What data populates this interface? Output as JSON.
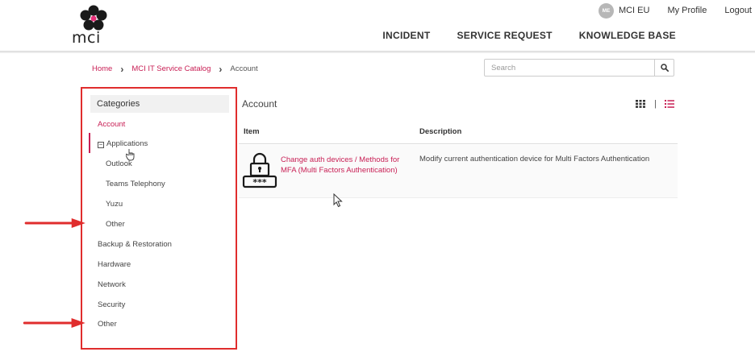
{
  "brand": {
    "logo_text": "mci",
    "accent_color": "#c81e54",
    "annotation_color": "#e02d2d"
  },
  "top_links": {
    "avatar_initials": "ME",
    "user_name": "MCI EU",
    "profile": "My Profile",
    "logout": "Logout"
  },
  "nav": {
    "items": [
      "INCIDENT",
      "SERVICE REQUEST",
      "KNOWLEDGE BASE"
    ]
  },
  "breadcrumb": {
    "items": [
      "Home",
      "MCI IT Service Catalog",
      "Account"
    ]
  },
  "search": {
    "placeholder": "Search",
    "value": "",
    "icon": "search-icon"
  },
  "sidebar": {
    "title": "Categories",
    "items": [
      {
        "label": "Account",
        "active": true
      },
      {
        "label": "Applications",
        "expanded": true
      },
      {
        "label": "Outlook",
        "level": 2
      },
      {
        "label": "Teams Telephony",
        "level": 2
      },
      {
        "label": "Yuzu",
        "level": 2
      },
      {
        "label": "Other",
        "level": 2
      },
      {
        "label": "Backup & Restoration"
      },
      {
        "label": "Hardware"
      },
      {
        "label": "Network"
      },
      {
        "label": "Security"
      },
      {
        "label": "Other"
      }
    ]
  },
  "content": {
    "title": "Account",
    "view_toggle": {
      "grid_icon": "grid-view-icon",
      "list_icon": "list-view-icon",
      "selected": "list"
    },
    "table": {
      "columns": [
        "Item",
        "Description"
      ],
      "rows": [
        {
          "icon": "lock-password-icon",
          "item": "Change auth devices / Methods for MFA (Multi Factors Authentication)",
          "description": "Modify current authentication device for Multi Factors Authentication"
        }
      ]
    }
  }
}
